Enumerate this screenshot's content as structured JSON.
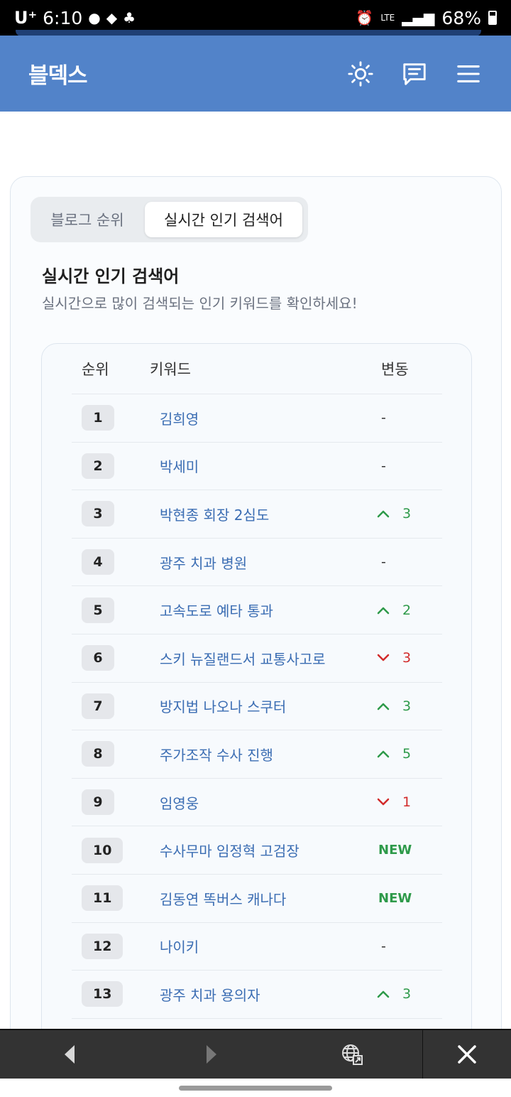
{
  "status_bar": {
    "carrier": "U⁺",
    "time": "6:10",
    "network": "LTE",
    "battery": "68%"
  },
  "header": {
    "logo": "블덱스"
  },
  "tabs": {
    "blog_rank": "블로그 순위",
    "realtime": "실시간 인기 검색어"
  },
  "section": {
    "title": "실시간 인기 검색어",
    "subtitle": "실시간으로 많이 검색되는 인기 키워드를 확인하세요!"
  },
  "table": {
    "headers": {
      "rank": "순위",
      "keyword": "키워드",
      "change": "변동"
    },
    "rows": [
      {
        "rank": "1",
        "keyword": "김희영",
        "change_type": "none",
        "change": "-"
      },
      {
        "rank": "2",
        "keyword": "박세미",
        "change_type": "none",
        "change": "-"
      },
      {
        "rank": "3",
        "keyword": "박현종 회장 2심도",
        "change_type": "up",
        "change": "3"
      },
      {
        "rank": "4",
        "keyword": "광주 치과 병원",
        "change_type": "none",
        "change": "-"
      },
      {
        "rank": "5",
        "keyword": "고속도로 예타 통과",
        "change_type": "up",
        "change": "2"
      },
      {
        "rank": "6",
        "keyword": "스키 뉴질랜드서 교통사고로",
        "change_type": "down",
        "change": "3"
      },
      {
        "rank": "7",
        "keyword": "방지법 나오나 스쿠터",
        "change_type": "up",
        "change": "3"
      },
      {
        "rank": "8",
        "keyword": "주가조작 수사 진행",
        "change_type": "up",
        "change": "5"
      },
      {
        "rank": "9",
        "keyword": "임영웅",
        "change_type": "down",
        "change": "1"
      },
      {
        "rank": "10",
        "keyword": "수사무마 임정혁 고검장",
        "change_type": "new",
        "change": "NEW"
      },
      {
        "rank": "11",
        "keyword": "김동연 똑버스 캐나다",
        "change_type": "new",
        "change": "NEW"
      },
      {
        "rank": "12",
        "keyword": "나이키",
        "change_type": "none",
        "change": "-"
      },
      {
        "rank": "13",
        "keyword": "광주 치과 용의자",
        "change_type": "up",
        "change": "3"
      }
    ]
  },
  "colors": {
    "header_bg": "#5283c9",
    "keyword": "#3b6db3",
    "up": "#2e9a4a",
    "down": "#d22b2b"
  },
  "icons": {
    "theme": "sun-icon",
    "chat": "message-icon",
    "menu": "hamburger-menu-icon",
    "back": "back-arrow-icon",
    "forward": "forward-arrow-icon",
    "web": "globe-icon",
    "close": "close-icon"
  }
}
